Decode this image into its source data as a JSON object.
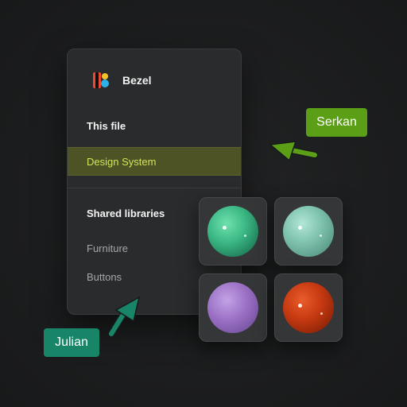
{
  "app": {
    "name": "Bezel",
    "logo_icon": "bezel-logo"
  },
  "sections": {
    "this_file": {
      "title": "This file",
      "items": [
        {
          "label": "Design System",
          "selected": true
        }
      ]
    },
    "shared_libraries": {
      "title": "Shared libraries",
      "items": [
        {
          "label": "Furniture"
        },
        {
          "label": "Buttons"
        }
      ]
    }
  },
  "swatches": [
    {
      "name": "green-sphere",
      "color": "#3dba86"
    },
    {
      "name": "sage-sphere",
      "color": "#80c4b0"
    },
    {
      "name": "purple-sphere",
      "color": "#9a70c4"
    },
    {
      "name": "orange-red-sphere",
      "color": "#c93b12"
    }
  ],
  "collaborators": [
    {
      "name": "Serkan",
      "color": "#5a9f16",
      "icon": "cursor-arrow-icon"
    },
    {
      "name": "Julian",
      "color": "#188569",
      "icon": "cursor-arrow-icon"
    }
  ],
  "colors": {
    "background": "#1c1d1e",
    "panel": "#2a2b2c",
    "selected_bg": "#4d5324",
    "selected_text": "#d4e45a"
  }
}
